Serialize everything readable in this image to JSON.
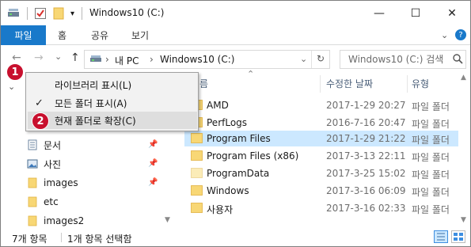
{
  "window": {
    "title": "Windows10 (C:)",
    "minimize": "—",
    "maximize": "☐",
    "close": "✕"
  },
  "ribbon": {
    "tabs": [
      "파일",
      "홈",
      "공유",
      "보기"
    ],
    "expand_icon": "chevron-down-icon",
    "help": "?"
  },
  "nav": {
    "back": "←",
    "forward": "→",
    "recent": "⌄",
    "up": "↑",
    "breadcrumbs": [
      "내 PC",
      "Windows10 (C:)"
    ],
    "search_placeholder": "Windows10 (C:) 검색"
  },
  "context_menu": {
    "items": [
      {
        "label": "라이브러리 표시(L)",
        "checked": false
      },
      {
        "label": "모든 폴더 표시(A)",
        "checked": true
      },
      {
        "label": "현재 폴더로 확장(C)",
        "checked": false,
        "highlighted": true
      }
    ]
  },
  "markers": [
    "1",
    "2"
  ],
  "nav_pane": {
    "items": [
      {
        "label": "문서",
        "icon": "documents-icon",
        "pinned": true
      },
      {
        "label": "사진",
        "icon": "pictures-icon",
        "pinned": true
      },
      {
        "label": "images",
        "icon": "folder-icon",
        "pinned": true
      },
      {
        "label": "etc",
        "icon": "folder-icon",
        "pinned": false
      },
      {
        "label": "images2",
        "icon": "folder-icon",
        "pinned": false
      }
    ]
  },
  "file_list": {
    "columns": {
      "name": "름",
      "date": "수정한 날짜",
      "type": "유형"
    },
    "rows": [
      {
        "name": "AMD",
        "date": "2017-1-29 20:27",
        "type": "파일 폴더",
        "selected": false
      },
      {
        "name": "PerfLogs",
        "date": "2016-7-16 20:47",
        "type": "파일 폴더",
        "selected": false
      },
      {
        "name": "Program Files",
        "date": "2017-1-29 21:22",
        "type": "파일 폴더",
        "selected": true
      },
      {
        "name": "Program Files (x86)",
        "date": "2017-3-13 22:11",
        "type": "파일 폴더",
        "selected": false
      },
      {
        "name": "ProgramData",
        "date": "2017-3-25 15:02",
        "type": "파일 폴더",
        "selected": false
      },
      {
        "name": "Windows",
        "date": "2017-3-16 06:09",
        "type": "파일 폴더",
        "selected": false
      },
      {
        "name": "사용자",
        "date": "2017-3-16 02:33",
        "type": "파일 폴더",
        "selected": false
      }
    ]
  },
  "status": {
    "item_count": "7개 항목",
    "selected": "1개 항목 선택함"
  },
  "colors": {
    "accent": "#1979ca",
    "selection": "#cce8ff",
    "folder": "#f8d775",
    "marker": "#c8102e"
  }
}
